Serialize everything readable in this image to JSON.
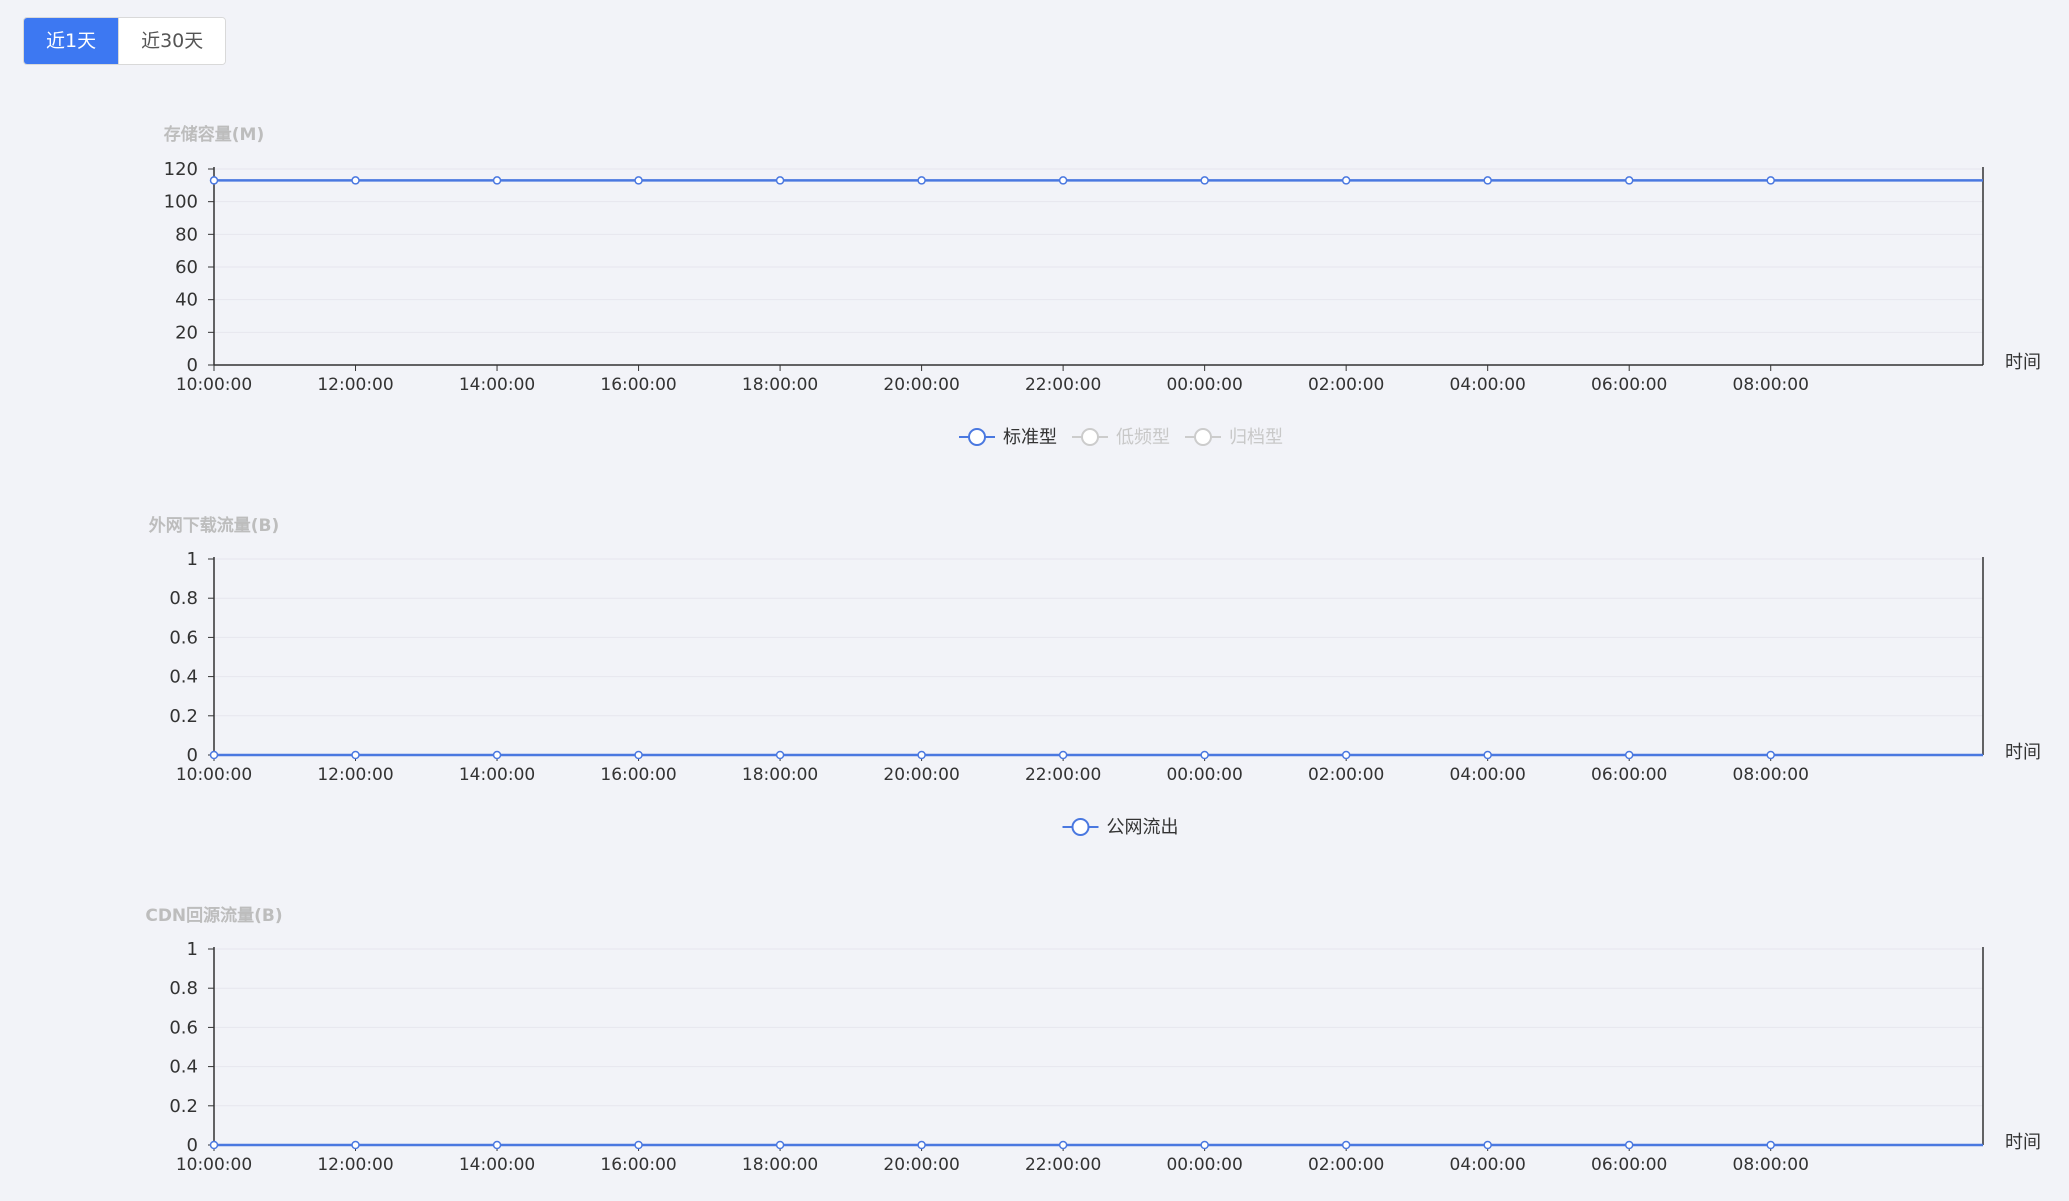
{
  "tabs": [
    {
      "label": "近1天",
      "active": true
    },
    {
      "label": "近30天",
      "active": false
    }
  ],
  "colors": {
    "accent": "#3d78f2",
    "series_line": "#4a78e0",
    "axis": "#333333",
    "grid": "#e6e6ee",
    "muted": "#bdbdbd",
    "tick_text": "#333333"
  },
  "chart_data": [
    {
      "type": "line",
      "ylabel": "存储容量(M)",
      "xlabel": "时间",
      "ylim": [
        0,
        120
      ],
      "yticks": [
        "0",
        "20",
        "40",
        "60",
        "80",
        "100",
        "120"
      ],
      "categories": [
        "10:00:00",
        "12:00:00",
        "14:00:00",
        "16:00:00",
        "18:00:00",
        "20:00:00",
        "22:00:00",
        "00:00:00",
        "02:00:00",
        "04:00:00",
        "06:00:00",
        "08:00:00"
      ],
      "series": [
        {
          "name": "标准型",
          "visible": true,
          "values": [
            113,
            113,
            113,
            113,
            113,
            113,
            113,
            113,
            113,
            113,
            113,
            113
          ]
        },
        {
          "name": "低频型",
          "visible": false,
          "values": []
        },
        {
          "name": "归档型",
          "visible": false,
          "values": []
        }
      ],
      "legend": "bottom-center",
      "grid": true
    },
    {
      "type": "line",
      "ylabel": "外网下载流量(B)",
      "xlabel": "时间",
      "ylim": [
        0,
        1
      ],
      "yticks": [
        "0",
        "0.2",
        "0.4",
        "0.6",
        "0.8",
        "1"
      ],
      "categories": [
        "10:00:00",
        "12:00:00",
        "14:00:00",
        "16:00:00",
        "18:00:00",
        "20:00:00",
        "22:00:00",
        "00:00:00",
        "02:00:00",
        "04:00:00",
        "06:00:00",
        "08:00:00"
      ],
      "series": [
        {
          "name": "公网流出",
          "visible": true,
          "values": [
            0,
            0,
            0,
            0,
            0,
            0,
            0,
            0,
            0,
            0,
            0,
            0
          ]
        }
      ],
      "legend": "bottom-center",
      "grid": true
    },
    {
      "type": "line",
      "ylabel": "CDN回源流量(B)",
      "xlabel": "时间",
      "ylim": [
        0,
        1
      ],
      "yticks": [
        "0",
        "0.2",
        "0.4",
        "0.6",
        "0.8",
        "1"
      ],
      "categories": [
        "10:00:00",
        "12:00:00",
        "14:00:00",
        "16:00:00",
        "18:00:00",
        "20:00:00",
        "22:00:00",
        "00:00:00",
        "02:00:00",
        "04:00:00",
        "06:00:00",
        "08:00:00"
      ],
      "series": [
        {
          "name": "",
          "visible": true,
          "values": [
            0,
            0,
            0,
            0,
            0,
            0,
            0,
            0,
            0,
            0,
            0,
            0
          ]
        }
      ],
      "legend": "none",
      "grid": true
    }
  ]
}
